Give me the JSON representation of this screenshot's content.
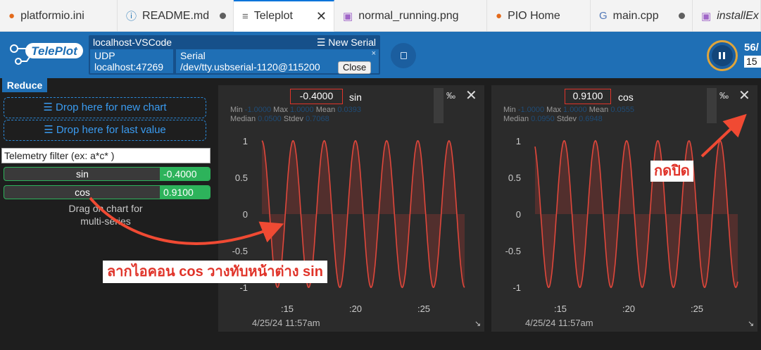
{
  "tabs": [
    {
      "label": "platformio.ini",
      "icon": "pio-icon",
      "state": "dot"
    },
    {
      "label": "README.md",
      "icon": "info-icon",
      "state": "dot"
    },
    {
      "label": "Teleplot",
      "icon": "file-lines-icon",
      "state": "close",
      "active": true
    },
    {
      "label": "normal_running.png",
      "icon": "image-icon",
      "state": "none"
    },
    {
      "label": "PIO Home",
      "icon": "pio-icon",
      "state": "none"
    },
    {
      "label": "main.cpp",
      "icon": "cpp-icon",
      "state": "dot"
    },
    {
      "label": "installEx",
      "icon": "image-icon",
      "state": "none"
    }
  ],
  "header": {
    "logo_text": "TelePlot",
    "connection_name": "localhost-VSCode",
    "new_serial_label": "New Serial",
    "udp_title": "UDP",
    "udp_address": "localhost:47269",
    "serial_title": "Serial",
    "serial_port": "/dev/tty.usbserial-1120@115200",
    "serial_close_x": "×",
    "close_button": "Close",
    "rate": "56/",
    "rate_box": "15"
  },
  "left": {
    "reduce": "Reduce",
    "drop_new": "Drop here for new chart",
    "drop_last": "Drop here for last value",
    "filter_placeholder": "Telemetry filter (ex: a*c* )",
    "telemetry": [
      {
        "name": "sin",
        "value": "-0.4000"
      },
      {
        "name": "cos",
        "value": "0.9100"
      }
    ],
    "drag_hint_1": "Drag on chart for",
    "drag_hint_2": "multi-series"
  },
  "charts": [
    {
      "name": "sin",
      "value": "-0.4000",
      "permil": "‰",
      "close": "✕",
      "stats": {
        "min_label": "Min",
        "min": "-1.0000",
        "max_label": "Max",
        "max": "1.0000",
        "mean_label": "Mean",
        "mean": "0.0393",
        "median_label": "Median",
        "median": "0.0500",
        "stdev_label": "Stdev",
        "stdev": "0.7068"
      },
      "date": "4/25/24 11:57am"
    },
    {
      "name": "cos",
      "value": "0.9100",
      "permil": "‰",
      "close": "✕",
      "stats": {
        "min_label": "Min",
        "min": "-1.0000",
        "max_label": "Max",
        "max": "1.0000",
        "mean_label": "Mean",
        "mean": "0.0555",
        "median_label": "Median",
        "median": "0.0950",
        "stdev_label": "Stdev",
        "stdev": "0.6948"
      },
      "date": "4/25/24 11:57am"
    }
  ],
  "chart_data": [
    {
      "type": "area",
      "title": "sin",
      "ylim": [
        -1.2,
        1.2
      ],
      "yticks": [
        "1",
        "0.5",
        "0",
        "-0.5",
        "-1"
      ],
      "xticks": [
        ":15",
        ":20",
        ":25"
      ],
      "phase": "sin",
      "cycles": 6.5,
      "line_color": "#e0473b"
    },
    {
      "type": "area",
      "title": "cos",
      "ylim": [
        -1.2,
        1.2
      ],
      "yticks": [
        "1",
        "0.5",
        "0",
        "-0.5",
        "-1"
      ],
      "xticks": [
        ":15",
        ":20",
        ":25"
      ],
      "phase": "cos",
      "cycles": 6.5,
      "line_color": "#e0473b"
    }
  ],
  "annotations": {
    "drag_label": "ลากไอคอน cos วางทับหน้าต่าง sin",
    "close_label": "กดปิด",
    "color": "#f04a33"
  }
}
